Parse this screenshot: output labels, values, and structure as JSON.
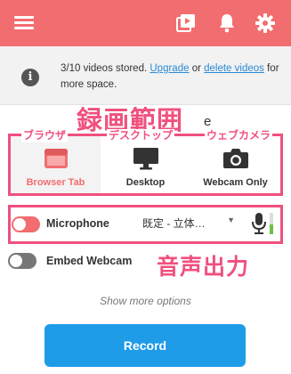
{
  "header": {
    "menu_icon": "hamburger-icon",
    "icons": [
      "video-library-icon",
      "bell-icon",
      "gear-icon"
    ],
    "color": "#f26d6f"
  },
  "notice": {
    "icon": "info-icon",
    "text_before": "3/10 videos stored. ",
    "upgrade_link": "Upgrade",
    "text_middle": " or ",
    "delete_link": "delete videos",
    "text_after": " for more space."
  },
  "annotation": {
    "title_jp": "録画範囲",
    "title_suffix": "e",
    "output_jp": "音声出力",
    "color": "#f0507e"
  },
  "modes": [
    {
      "label": "Browser Tab",
      "jp": "ブラウザ",
      "icon": "browser-tab-icon",
      "selected": true
    },
    {
      "label": "Desktop",
      "jp": "デスクトップ",
      "icon": "desktop-icon",
      "selected": false
    },
    {
      "label": "Webcam Only",
      "jp": "ウェブカメラ",
      "icon": "camera-icon",
      "selected": false
    }
  ],
  "microphone": {
    "label": "Microphone",
    "enabled": true,
    "selected_device": "既定 - 立体…",
    "level": 0.45
  },
  "webcam": {
    "label": "Embed Webcam",
    "enabled": false
  },
  "show_more": "Show more options",
  "record_button": "Record",
  "accent_colors": {
    "brand": "#f26d6f",
    "record": "#1f9ce8",
    "link": "#2a8ad4"
  }
}
